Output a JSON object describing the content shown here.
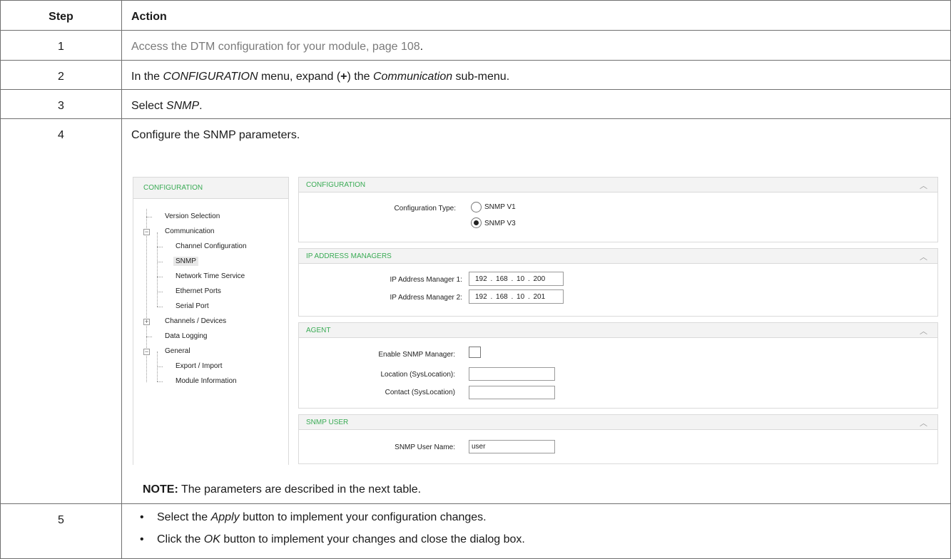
{
  "table": {
    "header": {
      "step": "Step",
      "action": "Action"
    },
    "rows": [
      {
        "step": "1",
        "link_text": "Access the DTM configuration for your module, page 108",
        "tail": "."
      },
      {
        "step": "2",
        "p1": "In the ",
        "p2": "CONFIGURATION",
        "p3": " menu, expand (",
        "p4": "+",
        "p5": ") the ",
        "p6": "Communication",
        "p7": " sub-menu."
      },
      {
        "step": "3",
        "p1": "Select ",
        "p2": "SNMP",
        "p3": "."
      },
      {
        "step": "4",
        "text": "Configure the SNMP parameters.",
        "note_label": "NOTE:",
        "note_text": " The parameters are described in the next table."
      },
      {
        "step": "5",
        "bullets": [
          {
            "p1": "Select the ",
            "p2": "Apply",
            "p3": " button to implement your configuration changes."
          },
          {
            "p1": "Click the ",
            "p2": "OK",
            "p3": " button to implement your changes and close the dialog box."
          }
        ]
      }
    ]
  },
  "screenshot": {
    "nav": {
      "title": "CONFIGURATION",
      "items": [
        "Version Selection",
        "Communication",
        "Channel Configuration",
        "SNMP",
        "Network Time Service",
        "Ethernet Ports",
        "Serial Port",
        "Channels / Devices",
        "Data Logging",
        "General",
        "Export / Import",
        "Module Information"
      ],
      "selected": "SNMP"
    },
    "configuration": {
      "title": "CONFIGURATION",
      "type_label": "Configuration Type:",
      "options": [
        "SNMP V1",
        "SNMP V3"
      ],
      "selected": "SNMP V3"
    },
    "ip_managers": {
      "title": "IP ADDRESS MANAGERS",
      "manager1_label": "IP Address Manager 1:",
      "manager1_value": "192  .  168  .  10  .  200",
      "manager2_label": "IP Address Manager 2:",
      "manager2_value": "192  .  168  .  10  .  201"
    },
    "agent": {
      "title": "AGENT",
      "enable_label": "Enable SNMP Manager:",
      "enable_checked": false,
      "location_label": "Location (SysLocation):",
      "location_value": "",
      "contact_label": "Contact (SysLocation)",
      "contact_value": ""
    },
    "snmp_user": {
      "title": "SNMP USER",
      "user_label": "SNMP User Name:",
      "user_value": "user"
    },
    "colors": {
      "accent": "#3aab55",
      "header_bg": "#f3f3f3",
      "border": "#dadada"
    },
    "icons": {
      "collapse": "chevron-up-icon",
      "expand": "plus-box-icon",
      "collapse_tree": "minus-box-icon"
    }
  }
}
